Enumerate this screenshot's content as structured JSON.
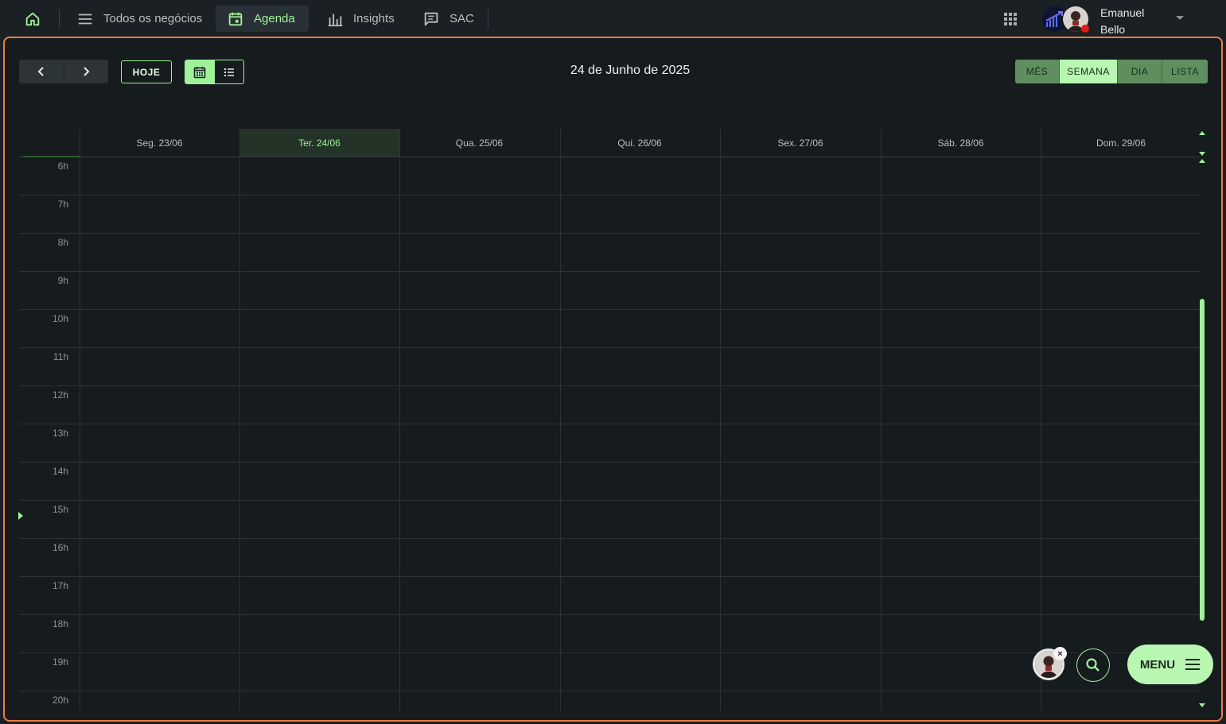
{
  "topbar": {
    "home_icon": "home-icon",
    "items": [
      {
        "label": "Todos os negócios",
        "icon": "menu-lines-icon",
        "active": false
      },
      {
        "label": "Agenda",
        "icon": "calendar-icon",
        "active": true
      },
      {
        "label": "Insights",
        "icon": "bar-chart-icon",
        "active": false
      },
      {
        "label": "SAC",
        "icon": "chat-icon",
        "active": false
      }
    ],
    "apps_icon": "apps-grid-icon",
    "user": {
      "first_name": "Emanuel",
      "last_name": "Bello",
      "status_color": "#e21b1b"
    }
  },
  "toolbar": {
    "prev_icon": "chevron-left-icon",
    "next_icon": "chevron-right-icon",
    "today_label": "HOJE",
    "date_title": "24 de Junho de 2025",
    "ranges": [
      {
        "label": "MÊS",
        "active": false
      },
      {
        "label": "SEMANA",
        "active": true
      },
      {
        "label": "DIA",
        "active": false
      },
      {
        "label": "LISTA",
        "active": false
      }
    ]
  },
  "calendar": {
    "days": [
      {
        "label": "Seg. 23/06",
        "today": false
      },
      {
        "label": "Ter. 24/06",
        "today": true
      },
      {
        "label": "Qua. 25/06",
        "today": false
      },
      {
        "label": "Qui. 26/06",
        "today": false
      },
      {
        "label": "Sex. 27/06",
        "today": false
      },
      {
        "label": "Sáb. 28/06",
        "today": false
      },
      {
        "label": "Dom. 29/06",
        "today": false
      }
    ],
    "hours": [
      "6h",
      "7h",
      "8h",
      "9h",
      "10h",
      "11h",
      "12h",
      "13h",
      "14h",
      "15h",
      "16h",
      "17h",
      "18h",
      "19h",
      "20h"
    ],
    "now_hour": "15h"
  },
  "fab": {
    "close_glyph": "×",
    "menu_label": "MENU"
  },
  "colors": {
    "accent": "#9ff29a",
    "frame_border": "#f07c43",
    "background": "#161b1e"
  }
}
